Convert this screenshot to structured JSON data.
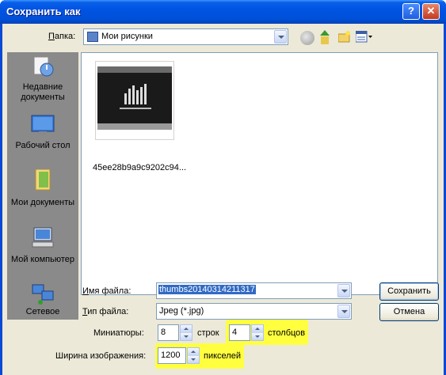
{
  "window": {
    "title": "Сохранить как",
    "help_glyph": "?",
    "close_glyph": "✕"
  },
  "folder": {
    "label": "Папка:",
    "label_underline": "П",
    "label_rest": "апка:",
    "value": "Мои рисунки"
  },
  "places": [
    {
      "label_line1": "Недавние",
      "label_line2": "документы",
      "icon": "recent-documents-icon"
    },
    {
      "label_line1": "Рабочий стол",
      "label_line2": "",
      "icon": "desktop-icon"
    },
    {
      "label_line1": "Мои документы",
      "label_line2": "",
      "icon": "my-documents-icon"
    },
    {
      "label_line1": "Мой компьютер",
      "label_line2": "",
      "icon": "my-computer-icon"
    },
    {
      "label_line1": "Сетевое",
      "label_line2": "",
      "icon": "network-icon"
    }
  ],
  "files": [
    {
      "name": "45ee28b9a9c9202c94..."
    }
  ],
  "filename": {
    "label_underline": "И",
    "label_rest": "мя файла:",
    "value": "thumbs20140314211317"
  },
  "filetype": {
    "label_underline": "Т",
    "label_rest": "ип файла:",
    "value": "Jpeg (*.jpg)"
  },
  "buttons": {
    "save": "Сохранить",
    "cancel": "Отмена"
  },
  "thumbnails": {
    "label": "Миниатюры:",
    "rows_value": "8",
    "rows_label": "строк",
    "cols_value": "4",
    "cols_label": "столбцов"
  },
  "image_width": {
    "label": "Ширина изображения:",
    "value": "1200",
    "unit": "пикселей"
  },
  "colors": {
    "title_bar": "#0054e3",
    "dialog_bg": "#ece9d8",
    "highlight": "#ffff40",
    "selection": "#316ac5"
  }
}
